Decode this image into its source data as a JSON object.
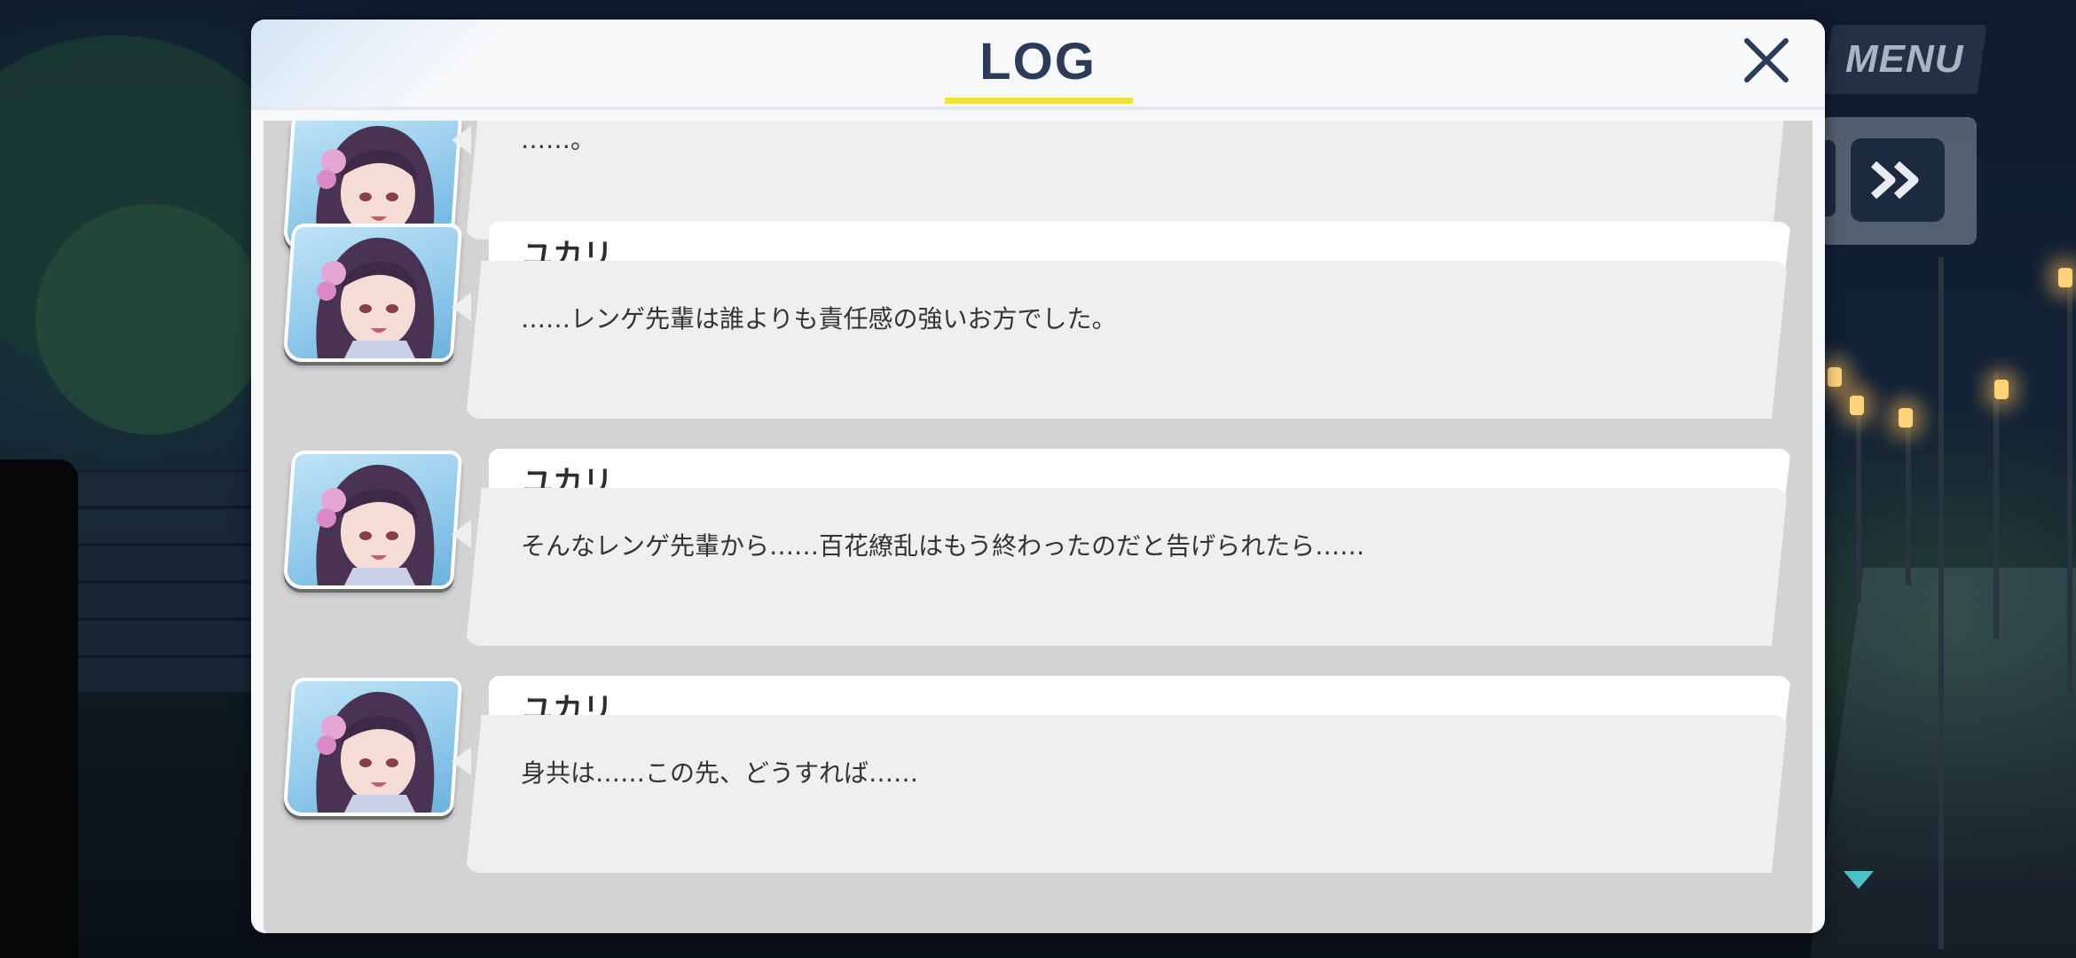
{
  "hud": {
    "menu_label": "MENU",
    "fast_forward_icon": "double-chevron-right-icon"
  },
  "log": {
    "title": "LOG",
    "close_icon": "close-icon",
    "accent_color": "#f3e13a",
    "title_color": "#2b3c58",
    "entries": [
      {
        "speaker": "",
        "message": "……。"
      },
      {
        "speaker": "ユカリ",
        "message": "……レンゲ先輩は誰よりも責任感の強いお方でした。"
      },
      {
        "speaker": "ユカリ",
        "message": "そんなレンゲ先輩から……百花繚乱はもう終わったのだと告げられたら……"
      },
      {
        "speaker": "ユカリ",
        "message": "身共は……この先、どうすれば……"
      }
    ]
  }
}
